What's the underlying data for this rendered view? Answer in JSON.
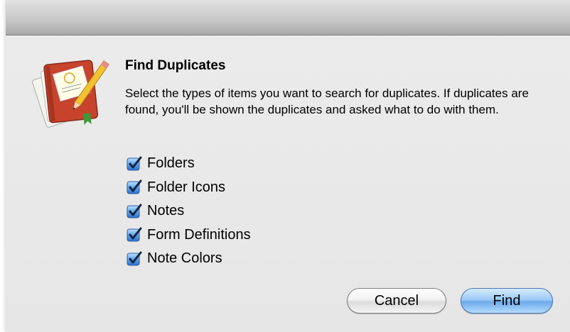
{
  "dialog": {
    "heading": "Find Duplicates",
    "description": "Select the types of items you want to search for duplicates. If duplicates are found, you'll be shown the duplicates and asked what to do with them.",
    "app_icon": "notebook-pencil-icon",
    "options": [
      {
        "label": "Folders",
        "checked": true
      },
      {
        "label": "Folder Icons",
        "checked": true
      },
      {
        "label": "Notes",
        "checked": true
      },
      {
        "label": "Form Definitions",
        "checked": true
      },
      {
        "label": "Note Colors",
        "checked": true
      }
    ],
    "buttons": {
      "cancel": "Cancel",
      "find": "Find"
    }
  },
  "colors": {
    "default_button": "#6eaaea",
    "checkbox_accent": "#3a78d6"
  }
}
